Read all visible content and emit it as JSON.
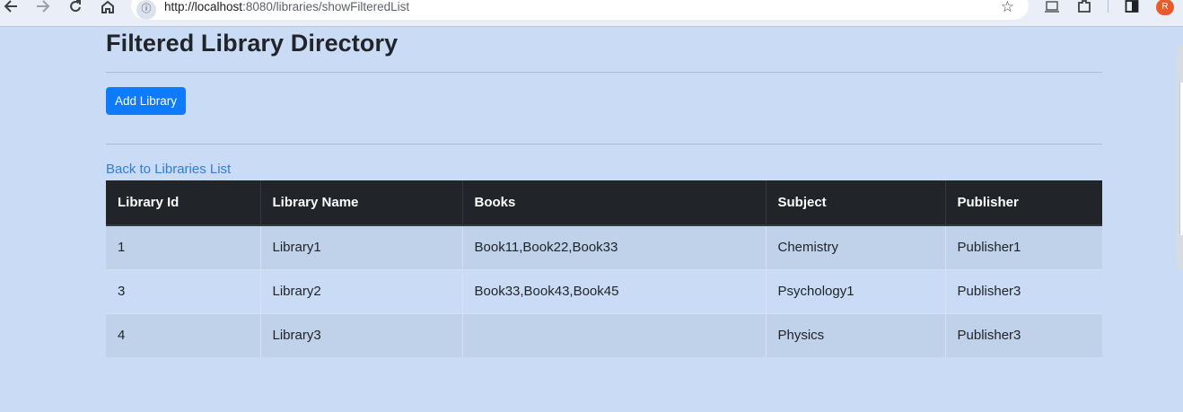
{
  "browser": {
    "url_host": "http://localhost",
    "url_rest": ":8080/libraries/showFilteredList",
    "profile_initial": "R"
  },
  "page": {
    "title": "Filtered Library Directory",
    "add_button_label": "Add Library",
    "back_link_label": "Back to Libraries List"
  },
  "table": {
    "headers": [
      "Library Id",
      "Library Name",
      "Books",
      "Subject",
      "Publisher"
    ],
    "rows": [
      [
        "1",
        "Library1",
        "Book11,Book22,Book33",
        "Chemistry",
        "Publisher1"
      ],
      [
        "3",
        "Library2",
        "Book33,Book43,Book45",
        "Psychology1",
        "Publisher3"
      ],
      [
        "4",
        "Library3",
        "",
        "Physics",
        "Publisher3"
      ]
    ]
  }
}
